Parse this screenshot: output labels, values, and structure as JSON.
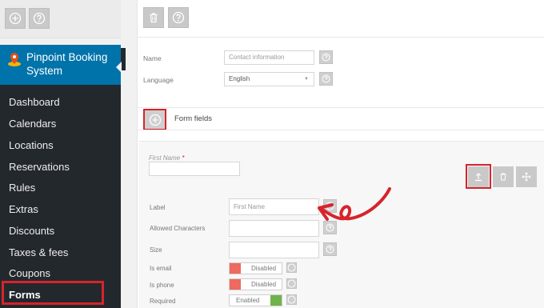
{
  "left_toolbar": {
    "add_icon": "plus-circle-icon",
    "help_icon": "question-icon"
  },
  "brand": {
    "name": "Pinpoint Booking System",
    "logo_icon": "map-pin-icon",
    "color": "#0073aa"
  },
  "menu": {
    "items": [
      {
        "label": "Dashboard",
        "active": false
      },
      {
        "label": "Calendars",
        "active": false
      },
      {
        "label": "Locations",
        "active": false
      },
      {
        "label": "Reservations",
        "active": false
      },
      {
        "label": "Rules",
        "active": false
      },
      {
        "label": "Extras",
        "active": false
      },
      {
        "label": "Discounts",
        "active": false
      },
      {
        "label": "Taxes & fees",
        "active": false
      },
      {
        "label": "Coupons",
        "active": false
      },
      {
        "label": "Forms",
        "active": true
      }
    ]
  },
  "right_toolbar": {
    "delete_icon": "trash-icon",
    "help_icon": "question-icon"
  },
  "form_settings": {
    "name_label": "Name",
    "name_value": "Contact information",
    "language_label": "Language",
    "language_value": "English"
  },
  "form_fields": {
    "title": "Form fields",
    "field": {
      "name": "First Name",
      "required_mark": "*",
      "label_label": "Label",
      "label_placeholder": "First Name",
      "allowed_chars_label": "Allowed Characters",
      "size_label": "Size",
      "is_email_label": "Is email",
      "is_email_value": "Disabled",
      "is_phone_label": "Is phone",
      "is_phone_value": "Disabled",
      "required_label": "Required",
      "required_value": "Enabled"
    }
  },
  "colors": {
    "highlight": "#d6242d",
    "disabled": "#ee6a5e",
    "enabled": "#6fb34a"
  }
}
